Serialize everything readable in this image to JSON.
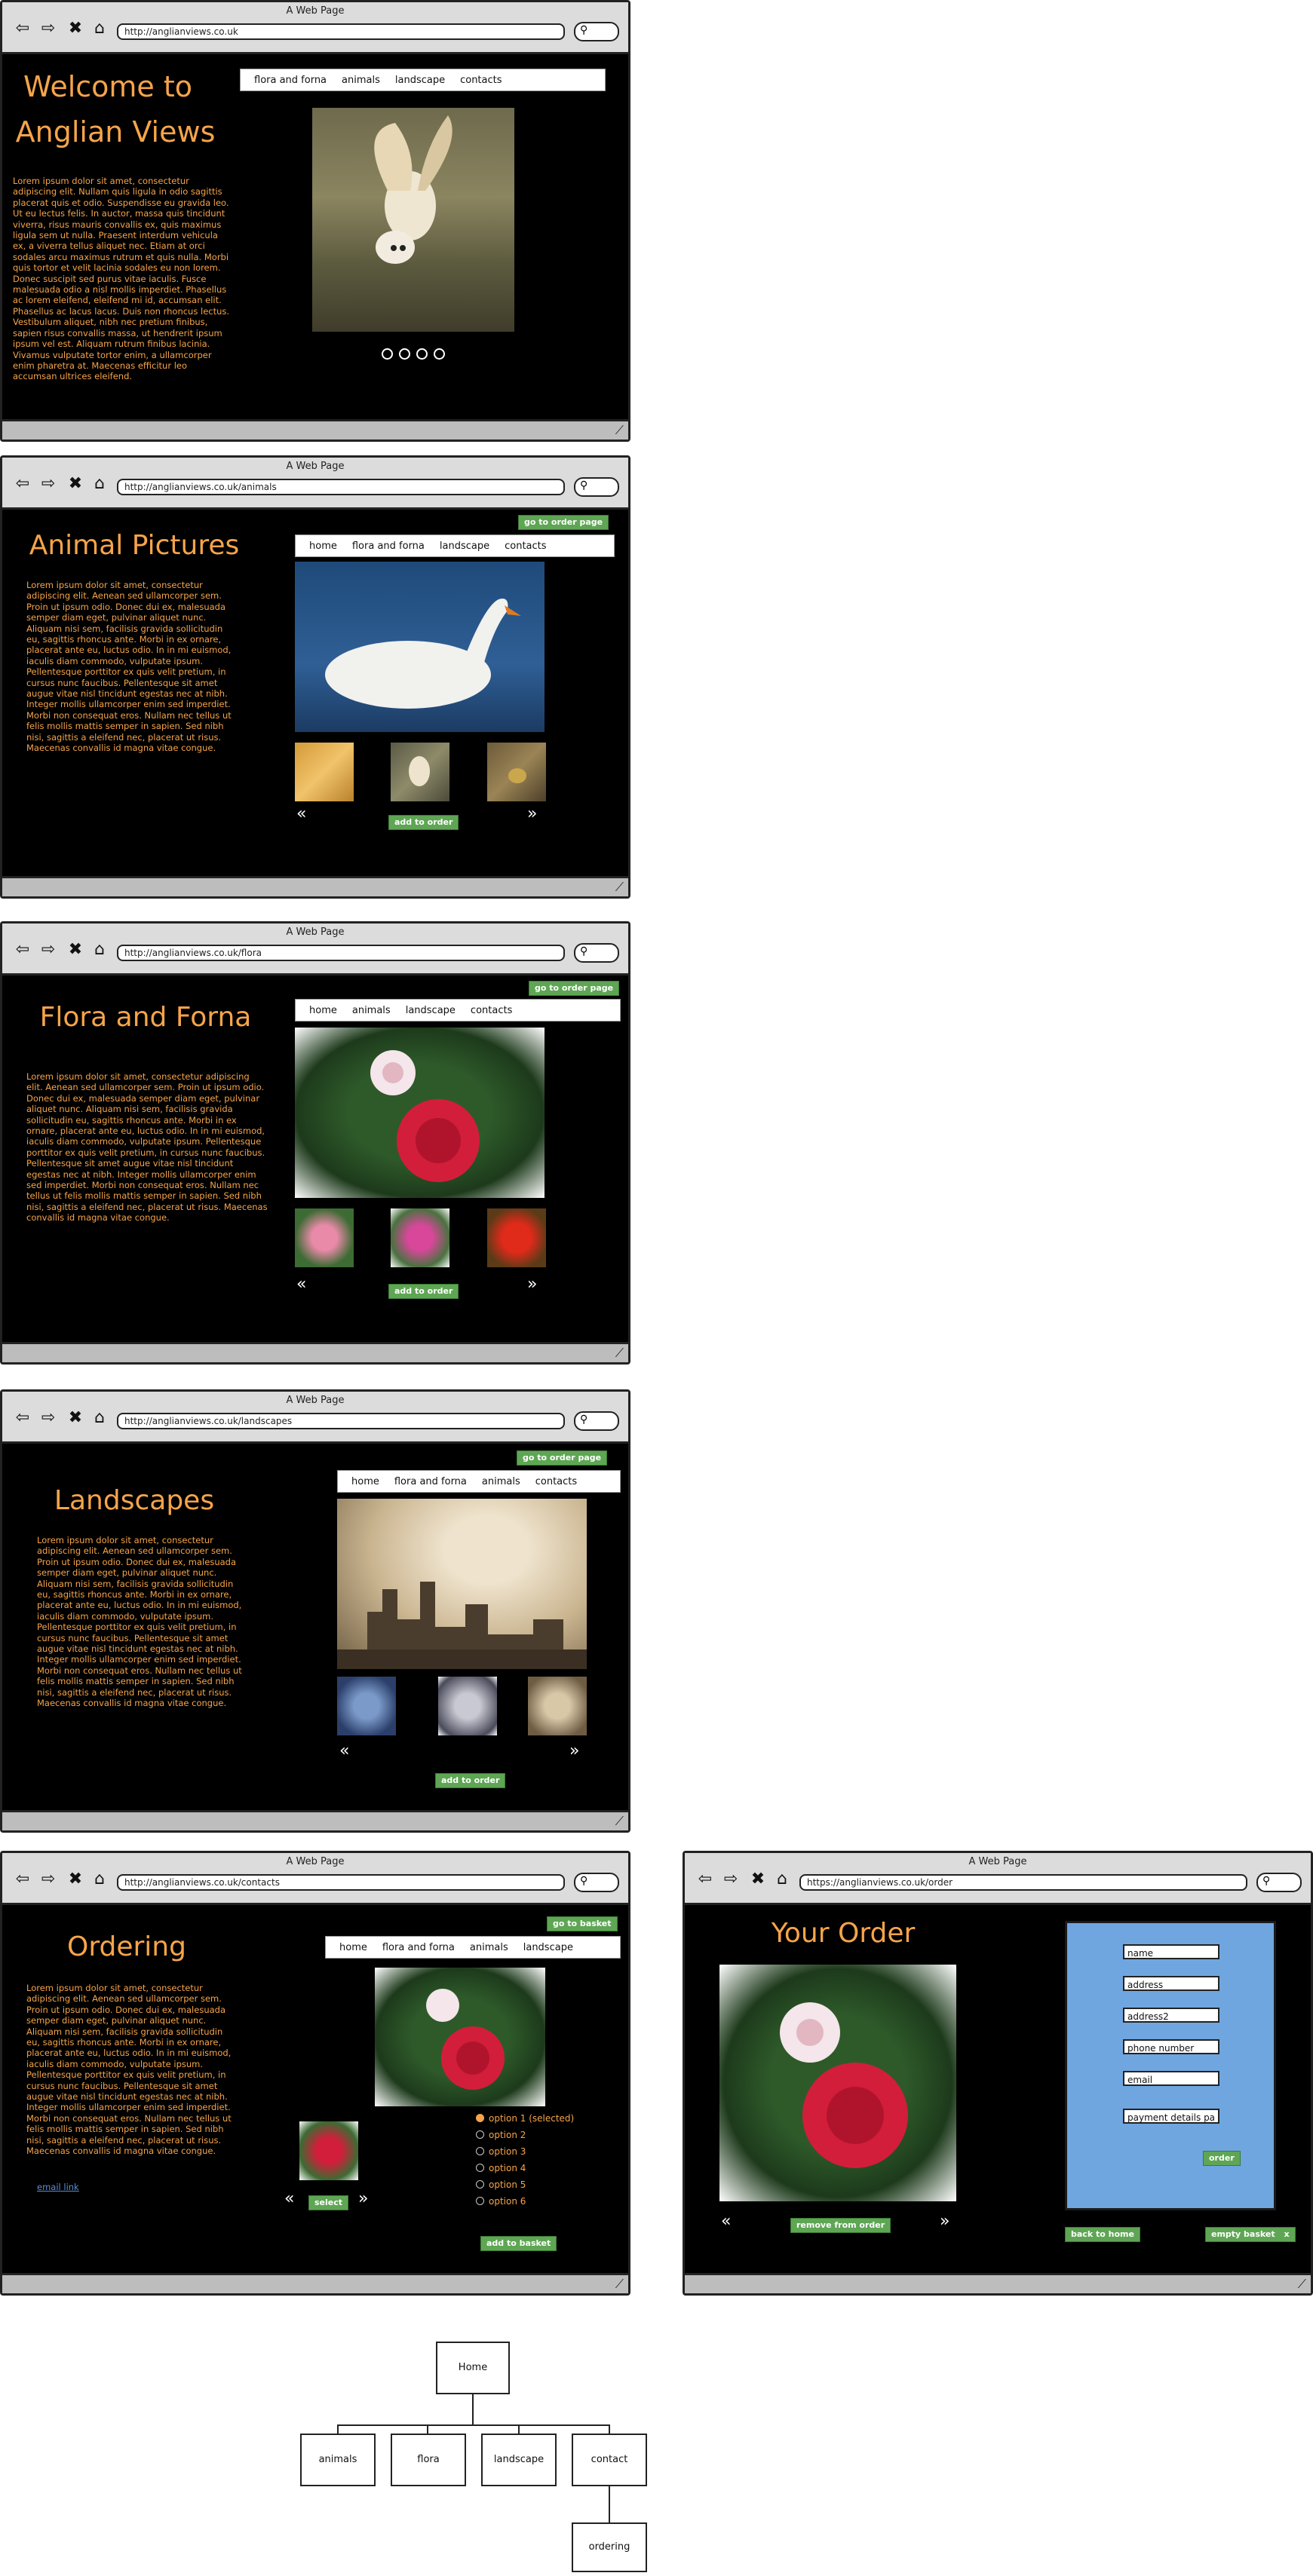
{
  "browser": {
    "window_title": "A Web Page"
  },
  "lorem_short": "Lorem ipsum dolor sit amet, consectetur adipiscing elit. Aenean sed ullamcorper sem. Proin ut ipsum odio. Donec dui ex, malesuada semper diam eget, pulvinar aliquet nunc. Aliquam nisi sem, facilisis gravida sollicitudin eu, sagittis rhoncus ante. Morbi in ex ornare, placerat ante eu, luctus odio. In in mi euismod, iaculis diam commodo, vulputate ipsum. Pellentesque porttitor ex quis velit pretium, in cursus nunc faucibus. Pellentesque sit amet augue vitae nisl tincidunt egestas nec at nibh. Integer mollis ullamcorper enim sed imperdiet. Morbi non consequat eros. Nullam nec tellus ut felis mollis mattis semper in sapien. Sed nibh nisi, sagittis a eleifend nec, placerat ut risus. Maecenas convallis id magna vitae congue.",
  "home": {
    "url": "http://anglianviews.co.uk",
    "title_line1": "Welcome to",
    "title_line2": "Anglian Views",
    "body": "Lorem ipsum dolor sit amet, consectetur adipiscing elit. Nullam quis ligula in odio sagittis placerat quis et odio. Suspendisse eu gravida leo. Ut eu lectus felis. In auctor, massa quis tincidunt viverra, risus mauris convallis ex, quis maximus ligula sem ut nulla. Praesent interdum vehicula ex, a viverra tellus aliquet nec. Etiam at orci sodales arcu maximus rutrum et quis nulla. Morbi quis tortor et velit lacinia sodales eu non lorem. Donec suscipit sed purus vitae iaculis. Fusce malesuada odio a nisl mollis imperdiet. Phasellus ac lorem eleifend, eleifend mi id, accumsan elit. Phasellus ac lacus lacus. Duis non rhoncus lectus. Vestibulum aliquet, nibh nec pretium finibus, sapien risus convallis massa, ut hendrerit ipsum ipsum vel est. Aliquam rutrum finibus lacinia. Vivamus vulputate tortor enim, a ullamcorper enim pharetra at. Maecenas efficitur leo accumsan ultrices eleifend.",
    "menu": [
      "flora and forna",
      "animals",
      "landscape",
      "contacts"
    ]
  },
  "animals": {
    "url": "http://anglianviews.co.uk/animals",
    "title": "Animal Pictures",
    "order_page": "go to order page",
    "menu": [
      "home",
      "flora and forna",
      "landscape",
      "contacts"
    ],
    "add": "add to order"
  },
  "flora": {
    "url": "http://anglianviews.co.uk/flora",
    "title": "Flora and Forna",
    "order_page": "go to order page",
    "menu": [
      "home",
      "animals",
      "landscape",
      "contacts"
    ],
    "add": "add to order"
  },
  "landscapes": {
    "url": "http://anglianviews.co.uk/landscapes",
    "title": "Landscapes",
    "order_page": "go to order page",
    "menu": [
      "home",
      "flora and forna",
      "animals",
      "contacts"
    ],
    "add": "add to order"
  },
  "contacts": {
    "url": "http://anglianviews.co.uk/contacts",
    "title": "Ordering",
    "basket": "go to basket",
    "menu": [
      "home",
      "flora and forna",
      "animals",
      "landscape"
    ],
    "email_link": "email link",
    "select": "select",
    "options": [
      "option 1 (selected)",
      "option 2",
      "option 3",
      "option 4",
      "option 5",
      "option 6"
    ],
    "add": "add to basket"
  },
  "order": {
    "url": "https://anglianviews.co.uk/order",
    "title": "Your Order",
    "remove": "remove from order",
    "fields": [
      "name",
      "address",
      "address2",
      "phone number",
      "email",
      "payment details pa"
    ],
    "order_btn": "order",
    "back": "back to home",
    "empty": "empty basket",
    "empty_icon": "x"
  },
  "sitemap": {
    "root": "Home",
    "children": [
      "animals",
      "flora",
      "landscape",
      "contact"
    ],
    "sub": "ordering"
  },
  "icons": {
    "back": "back-arrow-icon",
    "forward": "forward-arrow-icon",
    "stop": "close-icon",
    "home": "home-icon",
    "search": "search-icon",
    "resize": "resize-grip-icon"
  }
}
